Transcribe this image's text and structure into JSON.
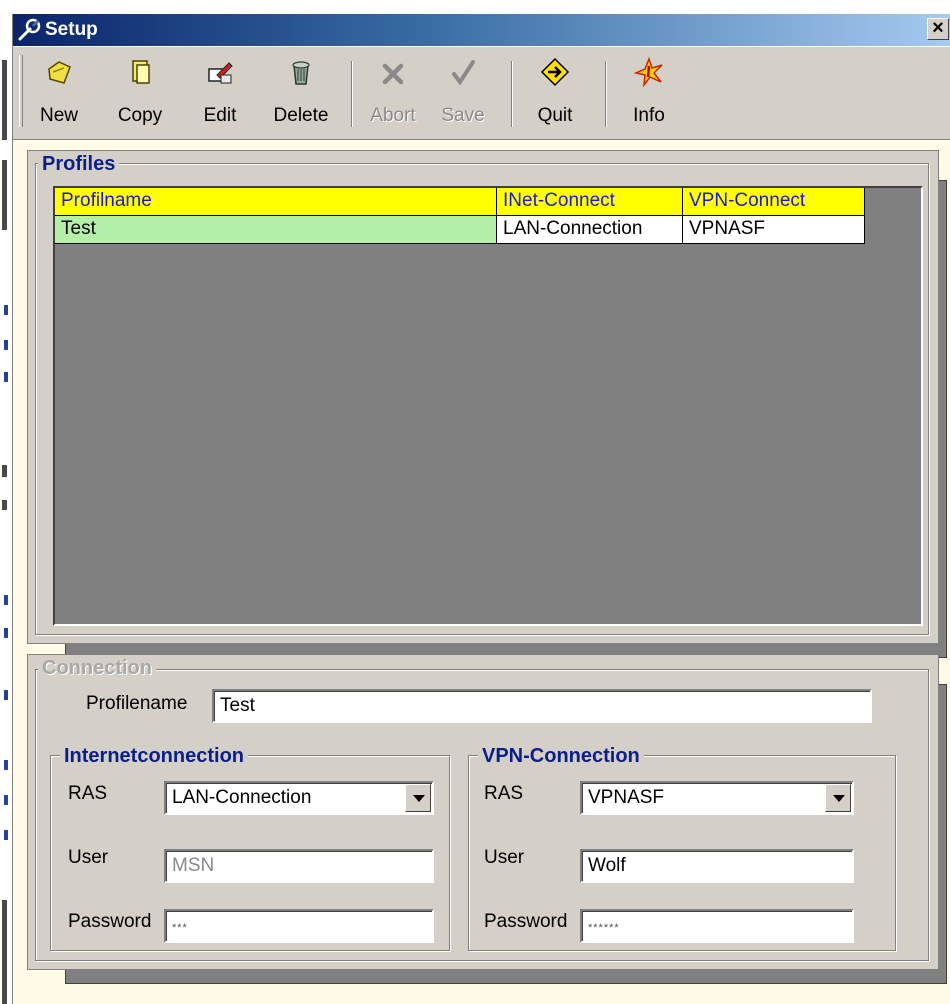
{
  "window": {
    "title": "Setup"
  },
  "toolbar": {
    "buttons": [
      {
        "label": "New",
        "icon": "new-folder-icon",
        "enabled": true
      },
      {
        "label": "Copy",
        "icon": "copy-icon",
        "enabled": true
      },
      {
        "label": "Edit",
        "icon": "edit-icon",
        "enabled": true
      },
      {
        "label": "Delete",
        "icon": "trash-icon",
        "enabled": true
      },
      {
        "label": "Abort",
        "icon": "x-icon",
        "enabled": false
      },
      {
        "label": "Save",
        "icon": "check-icon",
        "enabled": false
      },
      {
        "label": "Quit",
        "icon": "exit-arrow-icon",
        "enabled": true
      },
      {
        "label": "Info",
        "icon": "info-burst-icon",
        "enabled": true
      }
    ]
  },
  "profiles": {
    "title": "Profiles",
    "columns": [
      "Profilname",
      "INet-Connect",
      "VPN-Connect"
    ],
    "rows": [
      {
        "profile": "Test",
        "inet": "LAN-Connection",
        "vpn": "VPNASF"
      }
    ]
  },
  "connection": {
    "title": "Connection",
    "profilename_label": "Profilename",
    "profilename_value": "Test",
    "internet": {
      "title": "Internetconnection",
      "ras_label": "RAS",
      "ras_value": "LAN-Connection",
      "user_label": "User",
      "user_value": "MSN",
      "password_label": "Password",
      "password_value": "***"
    },
    "vpn": {
      "title": "VPN-Connection",
      "ras_label": "RAS",
      "ras_value": "VPNASF",
      "user_label": "User",
      "user_value": "Wolf",
      "password_label": "Password",
      "password_value": "******"
    }
  },
  "colors": {
    "title_gradient_start": "#0a246a",
    "grid_header": "#ffff00",
    "grid_header_text": "#1a1ad0",
    "selected_cell": "#b4f0a8",
    "group_title": "#0a1e8c"
  }
}
